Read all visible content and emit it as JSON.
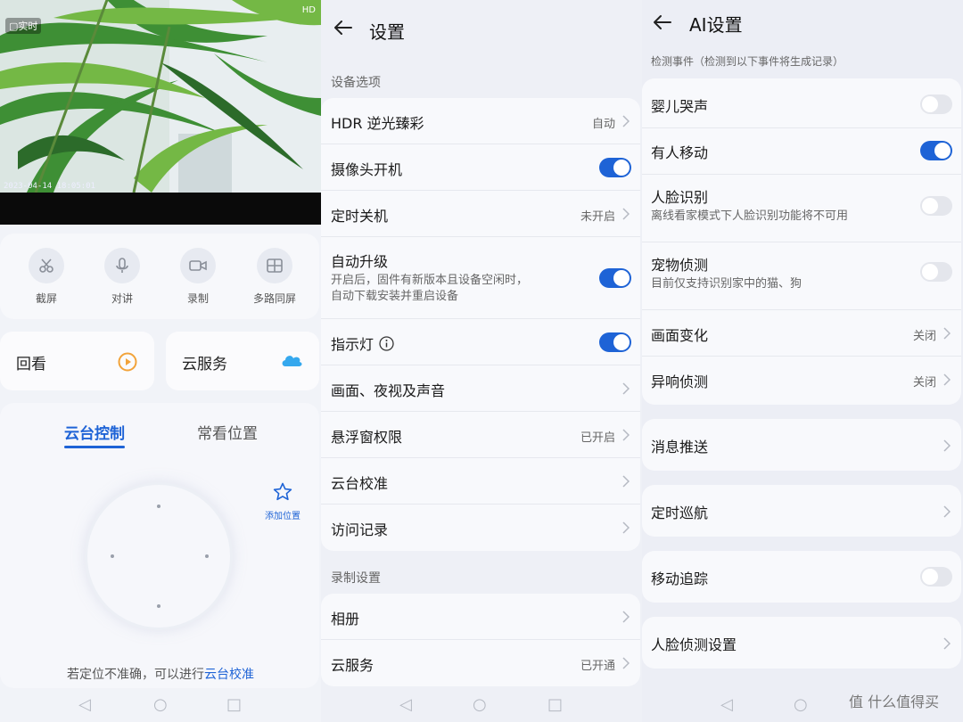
{
  "panel1": {
    "live_badge": "▢实时",
    "watermark": "HD",
    "timestamp": "2023-04-14 18:05:01",
    "tools": [
      {
        "label": "截屏",
        "icon": "scissors-icon"
      },
      {
        "label": "对讲",
        "icon": "microphone-icon"
      },
      {
        "label": "录制",
        "icon": "video-camera-icon"
      },
      {
        "label": "多路同屏",
        "icon": "multi-view-icon"
      }
    ],
    "playback_label": "回看",
    "cloud_label": "云服务",
    "tabs": [
      {
        "label": "云台控制",
        "active": true
      },
      {
        "label": "常看位置",
        "active": false
      }
    ],
    "add_position_label": "添加位置",
    "tip_text": "若定位不准确，可以进行",
    "tip_link": "云台校准",
    "accent": "#1e63d6"
  },
  "panel2": {
    "title": "设置",
    "section1": "设备选项",
    "rows1": [
      {
        "label": "HDR 逆光臻彩",
        "value": "自动",
        "control": "chevron"
      },
      {
        "label": "摄像头开机",
        "control": "toggle",
        "on": true
      },
      {
        "label": "定时关机",
        "value": "未开启",
        "control": "chevron"
      },
      {
        "label": "自动升级",
        "sub1": "开启后，固件有新版本且设备空闲时，",
        "sub2": "自动下载安装并重启设备",
        "control": "toggle",
        "on": true
      },
      {
        "label": "指示灯",
        "control": "toggle",
        "on": true
      },
      {
        "label": "画面、夜视及声音",
        "control": "chevron"
      },
      {
        "label": "悬浮窗权限",
        "value": "已开启",
        "control": "chevron"
      },
      {
        "label": "云台校准",
        "control": "chevron"
      },
      {
        "label": "访问记录",
        "control": "chevron"
      }
    ],
    "section2": "录制设置",
    "rows2": [
      {
        "label": "相册",
        "control": "chevron"
      },
      {
        "label": "云服务",
        "value": "已开通",
        "control": "chevron"
      }
    ]
  },
  "panel3": {
    "title": "AI设置",
    "subtitle": "检测事件（检测到以下事件将生成记录）",
    "rows": [
      {
        "label": "婴儿哭声",
        "control": "toggle",
        "on": false
      },
      {
        "label": "有人移动",
        "control": "toggle",
        "on": true
      },
      {
        "label": "人脸识别",
        "sub": "离线看家模式下人脸识别功能将不可用",
        "control": "toggle",
        "on": false
      },
      {
        "label": "宠物侦测",
        "sub": "目前仅支持识别家中的猫、狗",
        "control": "toggle",
        "on": false
      },
      {
        "label": "画面变化",
        "value": "关闭",
        "control": "chevron"
      },
      {
        "label": "异响侦测",
        "value": "关闭",
        "control": "chevron"
      }
    ],
    "push_label": "消息推送",
    "cruise_label": "定时巡航",
    "tracking_label": "移动追踪",
    "tracking_on": false,
    "face_settings_label": "人脸侦测设置",
    "watermark": "值 什么值得买"
  }
}
